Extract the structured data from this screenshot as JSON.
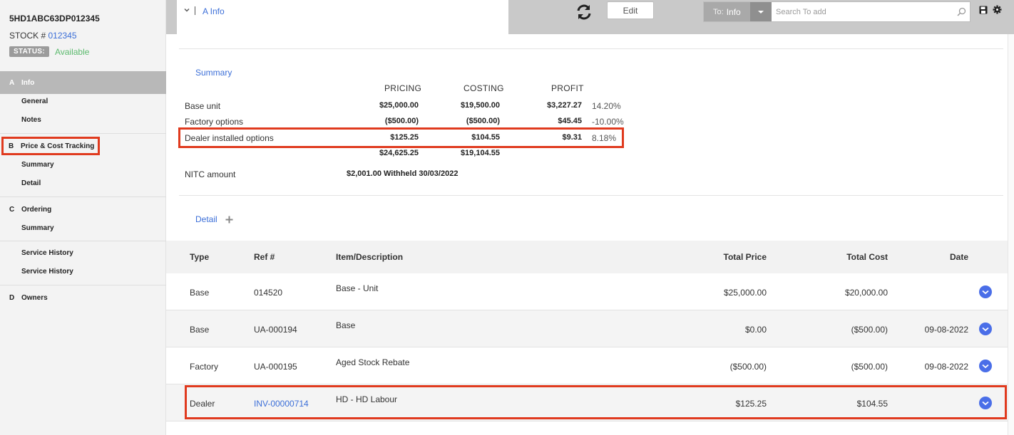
{
  "vehicle": {
    "vin": "5HD1ABC63DP012345",
    "stock_label": "STOCK #",
    "stock_number": "012345",
    "status_label": "STATUS:",
    "status_value": "Available"
  },
  "sidebar": {
    "sections": [
      {
        "letter": "A",
        "label": "Info",
        "items": [
          "General",
          "Notes"
        ]
      },
      {
        "letter": "B",
        "label": "Price & Cost Tracking",
        "items": [
          "Summary",
          "Detail"
        ]
      },
      {
        "letter": "C",
        "label": "Ordering",
        "items": [
          "Summary"
        ]
      },
      {
        "letter": "",
        "label": "",
        "items": [
          "Service History",
          "Service History"
        ]
      },
      {
        "letter": "D",
        "label": "Owners",
        "items": []
      }
    ]
  },
  "topbar": {
    "tab_label": "A Info",
    "edit_label": "Edit",
    "to_label": "To:",
    "to_value": "Info",
    "search_placeholder": "Search To add"
  },
  "summary": {
    "link_label": "Summary",
    "headers": {
      "pricing": "PRICING",
      "costing": "COSTING",
      "profit": "PROFIT"
    },
    "rows": [
      {
        "label": "Base unit",
        "pricing": "$25,000.00",
        "costing": "$19,500.00",
        "profit": "$3,227.27",
        "pct": "14.20%"
      },
      {
        "label": "Factory options",
        "pricing": "($500.00)",
        "costing": "($500.00)",
        "profit": "$45.45",
        "pct": "-10.00%"
      },
      {
        "label": "Dealer installed options",
        "pricing": "$125.25",
        "costing": "$104.55",
        "profit": "$9.31",
        "pct": "8.18%"
      }
    ],
    "totals": {
      "pricing": "$24,625.25",
      "costing": "$19,104.55"
    },
    "nitc_label": "NITC amount",
    "nitc_value": "$2,001.00  Withheld 30/03/2022"
  },
  "detail": {
    "link_label": "Detail",
    "columns": {
      "type": "Type",
      "ref": "Ref #",
      "desc": "Item/Description",
      "price": "Total Price",
      "cost": "Total Cost",
      "date": "Date"
    },
    "rows": [
      {
        "type": "Base",
        "ref": "014520",
        "desc": "Base - Unit",
        "price": "$25,000.00",
        "cost": "$20,000.00",
        "date": ""
      },
      {
        "type": "Base",
        "ref": "UA-000194",
        "desc": "Base",
        "price": "$0.00",
        "cost": "($500.00)",
        "date": "09-08-2022"
      },
      {
        "type": "Factory",
        "ref": "UA-000195",
        "desc": "Aged Stock Rebate",
        "price": "($500.00)",
        "cost": "($500.00)",
        "date": "09-08-2022"
      },
      {
        "type": "Dealer",
        "ref": "INV-00000714",
        "desc": "HD - HD Labour",
        "price": "$125.25",
        "cost": "$104.55",
        "date": ""
      }
    ]
  },
  "colors": {
    "accent": "#3c6fd8",
    "highlight": "#e03a1e",
    "status": "#5cba6e"
  }
}
